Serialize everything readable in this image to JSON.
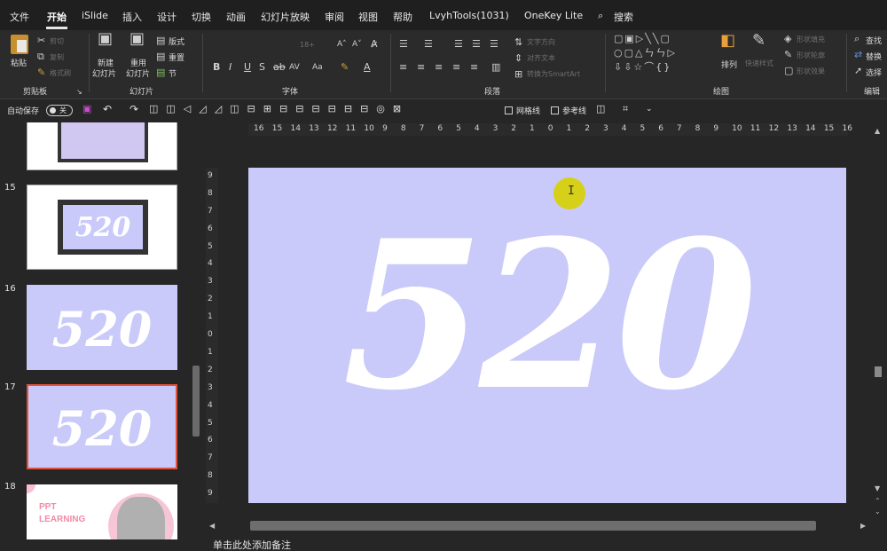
{
  "menu": {
    "items": [
      "文件",
      "开始",
      "iSlide",
      "插入",
      "设计",
      "切换",
      "动画",
      "幻灯片放映",
      "审阅",
      "视图",
      "帮助",
      "LvyhTools(1031)",
      "OneKey Lite"
    ],
    "active": "开始",
    "search_label": "搜索"
  },
  "ribbon": {
    "clipboard": {
      "paste": "粘贴",
      "cut": "剪切",
      "copy": "复制",
      "format_painter": "格式刷",
      "label": "剪贴板"
    },
    "slides": {
      "new": "新建\n幻灯片",
      "new_line1": "新建",
      "new_line2": "幻灯片",
      "reuse_line1": "重用",
      "reuse_line2": "幻灯片",
      "layout": "版式",
      "reset": "重置",
      "section": "节",
      "label": "幻灯片"
    },
    "font": {
      "label": "字体",
      "size": "18+"
    },
    "paragraph": {
      "label": "段落",
      "text_direction": "文字方向",
      "align_text": "对齐文本",
      "smartart": "转换为SmartArt"
    },
    "drawing": {
      "arrange": "排列",
      "quick_styles": "快速样式",
      "shape_fill": "形状填充",
      "shape_outline": "形状轮廓",
      "shape_effects": "形状效果",
      "label": "绘图"
    },
    "editing": {
      "find": "查找",
      "replace": "替换",
      "select": "选择",
      "label": "编辑"
    }
  },
  "qat": {
    "autosave_label": "自动保存",
    "autosave_state": "关",
    "gridlines": "网格线",
    "guides": "参考线"
  },
  "thumbnails": [
    {
      "number": "",
      "text": ""
    },
    {
      "number": "15",
      "text": "520"
    },
    {
      "number": "16",
      "text": "520"
    },
    {
      "number": "17",
      "text": "520",
      "selected": true
    },
    {
      "number": "18",
      "line1": "PPT",
      "line2": "LEARNING"
    }
  ],
  "ruler": {
    "h_labels": [
      "16",
      "15",
      "14",
      "13",
      "12",
      "11",
      "10",
      "9",
      "8",
      "7",
      "6",
      "5",
      "4",
      "3",
      "2",
      "1",
      "0",
      "1",
      "2",
      "3",
      "4",
      "5",
      "6",
      "7",
      "8",
      "9",
      "10",
      "11",
      "12",
      "13",
      "14",
      "15",
      "16"
    ],
    "v_labels": [
      "9",
      "8",
      "7",
      "6",
      "5",
      "4",
      "3",
      "2",
      "1",
      "0",
      "1",
      "2",
      "3",
      "4",
      "5",
      "6",
      "7",
      "8",
      "9"
    ]
  },
  "slide": {
    "main_text": "520",
    "background_color": "#c9c9fa"
  },
  "notes_placeholder": "单击此处添加备注",
  "colors": {
    "accent_selected": "#e0533d",
    "slide_bg": "#c9c9fa",
    "cursor_highlight": "#d8d000"
  }
}
